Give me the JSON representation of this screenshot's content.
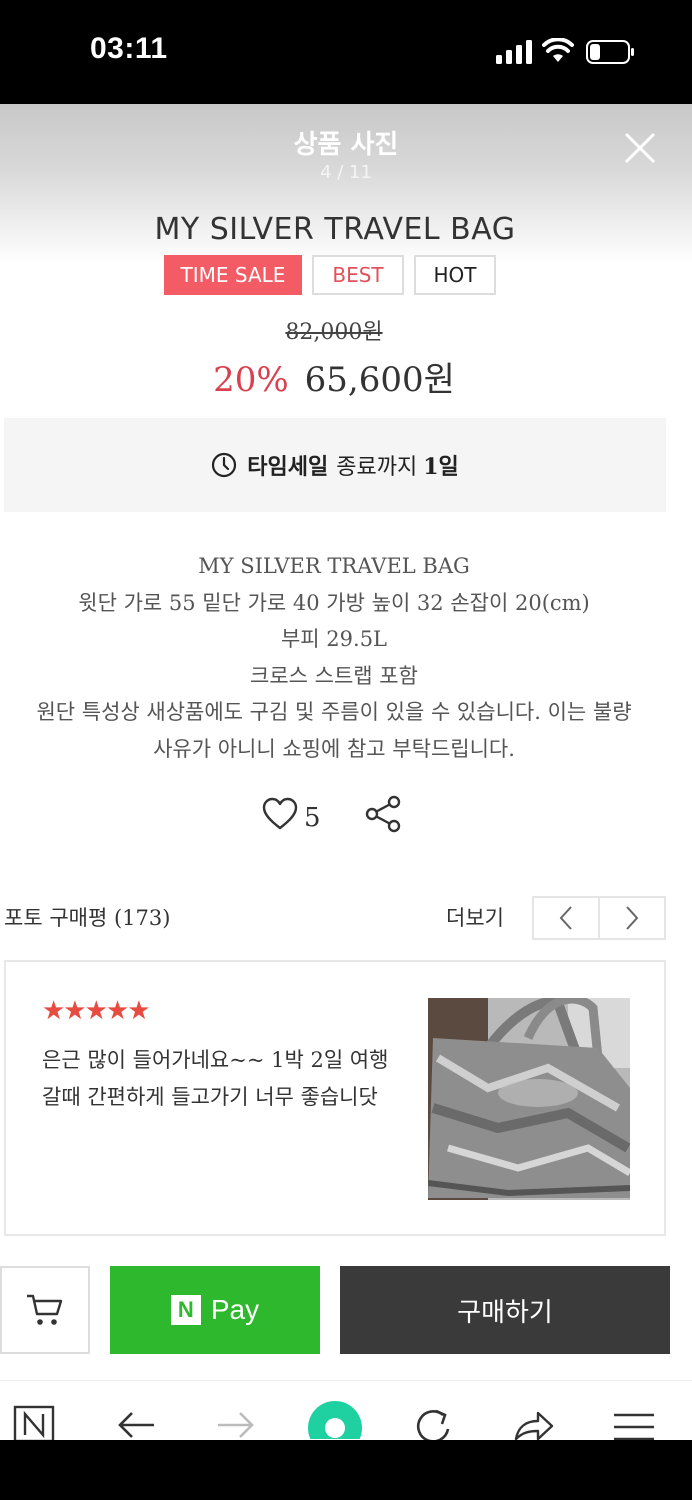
{
  "status_bar": {
    "time": "03:11"
  },
  "gallery": {
    "title": "상품 사진",
    "counter": "4 / 11"
  },
  "product": {
    "name": "MY SILVER TRAVEL BAG",
    "badges": [
      "TIME SALE",
      "BEST",
      "HOT"
    ],
    "original_price": "82,000원",
    "discount": "20%",
    "sale_price": "65,600원"
  },
  "timesale": {
    "label": "타임세일",
    "middle": "종료까지",
    "remaining": "1일"
  },
  "description": [
    "MY SILVER TRAVEL BAG",
    "윗단 가로 55 밑단 가로 40 가방 높이 32 손잡이 20(cm)",
    "부피 29.5L",
    "크로스 스트랩 포함",
    "원단 특성상 새상품에도 구김 및 주름이 있을 수 있습니다. 이는 불량",
    "사유가 아니니 쇼핑에 참고 부탁드립니다."
  ],
  "actions": {
    "likes": "5"
  },
  "reviews": {
    "title": "포토 구매평 (173)",
    "more": "더보기",
    "card": {
      "stars": "★★★★★",
      "text": "은근 많이 들어가네요~~ 1박 2일 여행갈때 간편하게 들고가기 너무 좋습니닷"
    }
  },
  "bottom": {
    "npay_logo": "N",
    "npay_label": "Pay",
    "buy_label": "구매하기"
  },
  "colors": {
    "accent_red": "#f35c64",
    "npay_green": "#2eb82e",
    "buy_dark": "#3a3a3a"
  }
}
